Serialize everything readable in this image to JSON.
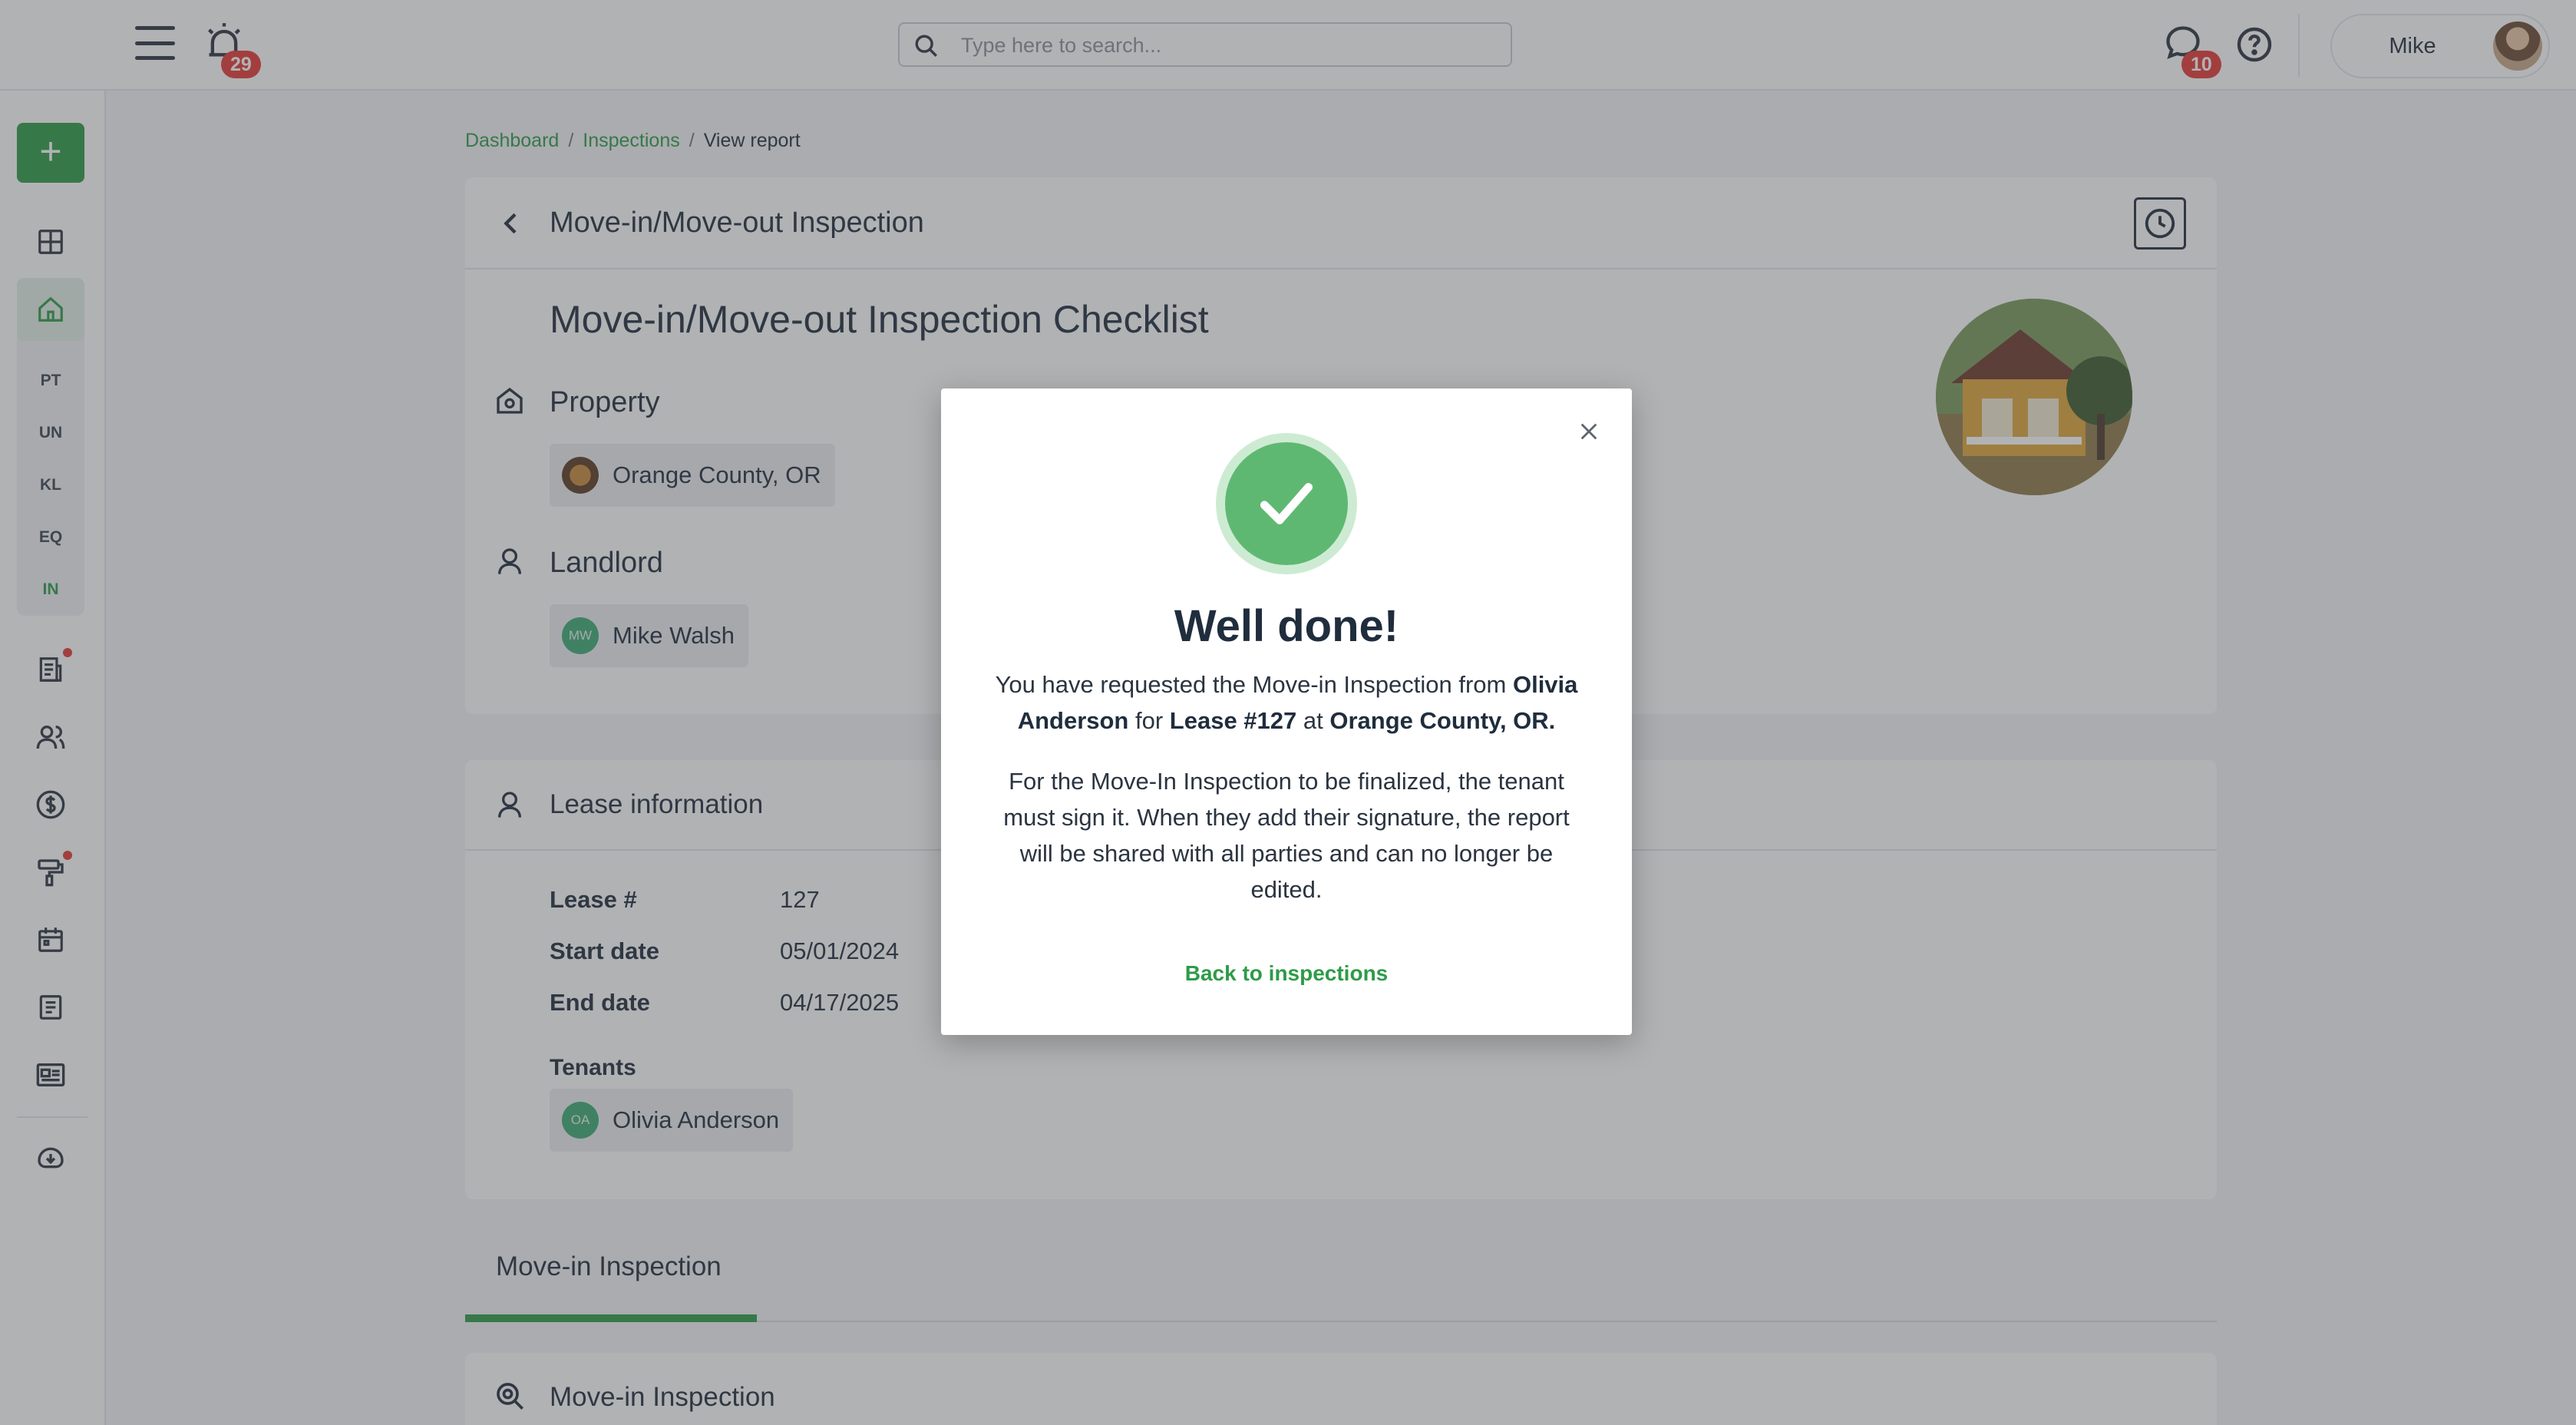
{
  "topbar": {
    "alarm_count": "29",
    "search_placeholder": "Type here to search...",
    "messages_count": "10",
    "user_name": "Mike"
  },
  "sidebar": {
    "add_label": "+",
    "abbrs": [
      "PT",
      "UN",
      "KL",
      "EQ",
      "IN"
    ],
    "active_abbr": "IN"
  },
  "breadcrumb": {
    "items": [
      "Dashboard",
      "Inspections"
    ],
    "separator": "/",
    "current": "View report"
  },
  "report": {
    "header_title": "Move-in/Move-out Inspection",
    "checklist_title": "Move-in/Move-out Inspection Checklist",
    "property_label": "Property",
    "property_name": "Orange County, OR",
    "landlord_label": "Landlord",
    "landlord_initials": "MW",
    "landlord_name": "Mike Walsh"
  },
  "lease": {
    "title": "Lease information",
    "fields": [
      {
        "label": "Lease #",
        "value": "127"
      },
      {
        "label": "Start date",
        "value": "05/01/2024"
      },
      {
        "label": "End date",
        "value": "04/17/2025"
      }
    ],
    "tenants_label": "Tenants",
    "tenant_initials": "OA",
    "tenant_name": "Olivia Anderson"
  },
  "tabs": {
    "active": "Move-in Inspection"
  },
  "section": {
    "title": "Move-in Inspection"
  },
  "modal": {
    "heading": "Well done!",
    "p1_pre": "You have requested the Move-in Inspection from ",
    "p1_tenant": "Olivia Anderson",
    "p1_for": " for ",
    "p1_lease": "Lease #127",
    "p1_at": " at ",
    "p1_property": "Orange County, OR.",
    "p2": "For the Move-In Inspection to be finalized, the tenant must sign it. When they add their signature, the report will be shared with all parties and can no longer be edited.",
    "back_link": "Back to inspections"
  },
  "colors": {
    "accent": "#2e9b48",
    "badge": "#e53935",
    "success_circle": "#5fb872"
  }
}
